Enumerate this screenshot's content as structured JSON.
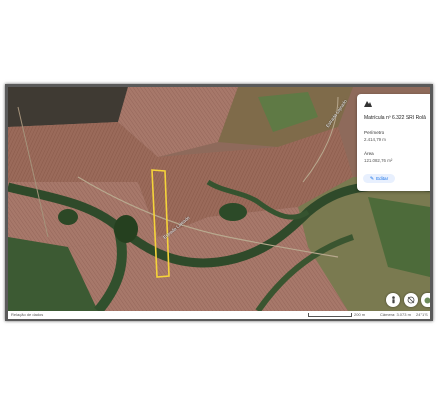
{
  "info_card": {
    "title": "Matrícula nº 6.322 SRI Rolâ",
    "perimeter_label": "Perímetro",
    "perimeter_value": "2.414,79 m",
    "area_label": "Área",
    "area_value": "121.082,76 m²",
    "edit_label": "Editar",
    "brand_icon": "earth-brand-icon"
  },
  "map_labels": {
    "road_left": "Estrada Lajeado",
    "road_right": "Estrada Lajeado"
  },
  "footer": {
    "attribution": "Relação de dados",
    "scale": "200 m",
    "camera": "Câmera: 3.073 m",
    "coords": "24°1'S"
  },
  "controls": {
    "locate_icon": "person-icon",
    "layers_icon": "layers-off-icon",
    "view_icon": "globe-icon"
  },
  "colors": {
    "parcel_outline": "#f5d33a",
    "accent": "#1a73e8"
  }
}
